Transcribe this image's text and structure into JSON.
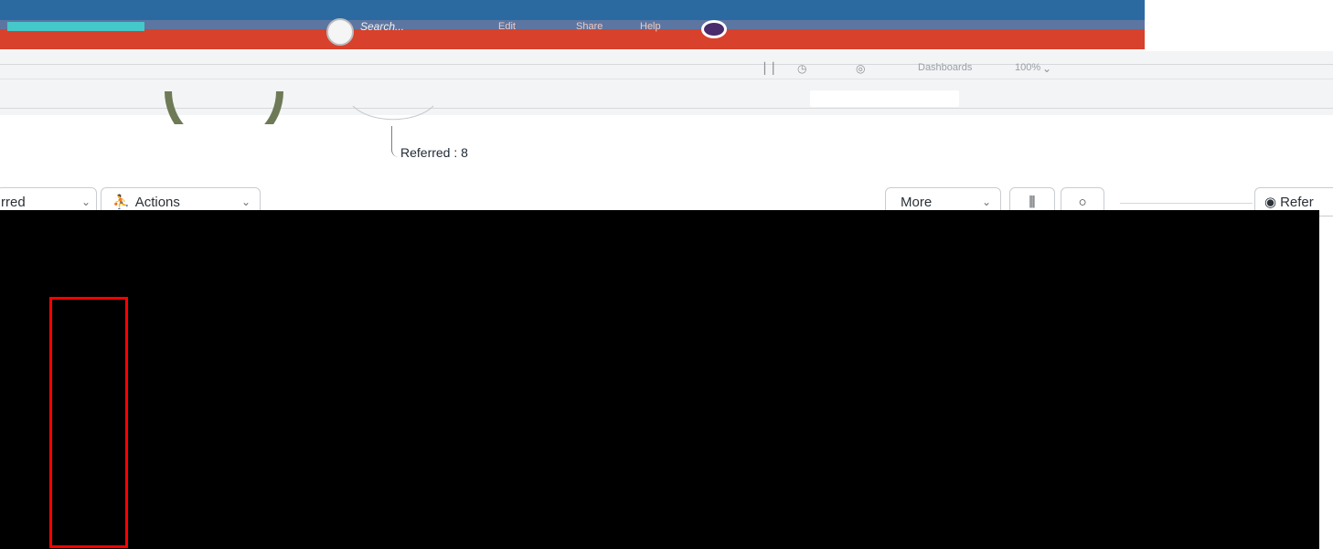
{
  "header": {
    "search_placeholder": "Search...",
    "nav_links": [
      "Edit",
      "Share",
      "Help"
    ]
  },
  "toolbar": {
    "dashboards_label": "Dashboards",
    "zoom_label": "100%"
  },
  "gauge": {
    "label": "Referred : 8",
    "value": 8,
    "fill_color": "#6e7a57"
  },
  "filters": {
    "status_label": "rred",
    "actions_label": "Actions",
    "more_label": "More",
    "columns_icon": "columns-icon",
    "search_icon": "search-icon",
    "refer_label": "Refer"
  },
  "colors": {
    "header_red": "#d8412c",
    "header_blue": "#2b6aa1",
    "highlight": "#ff0000"
  }
}
